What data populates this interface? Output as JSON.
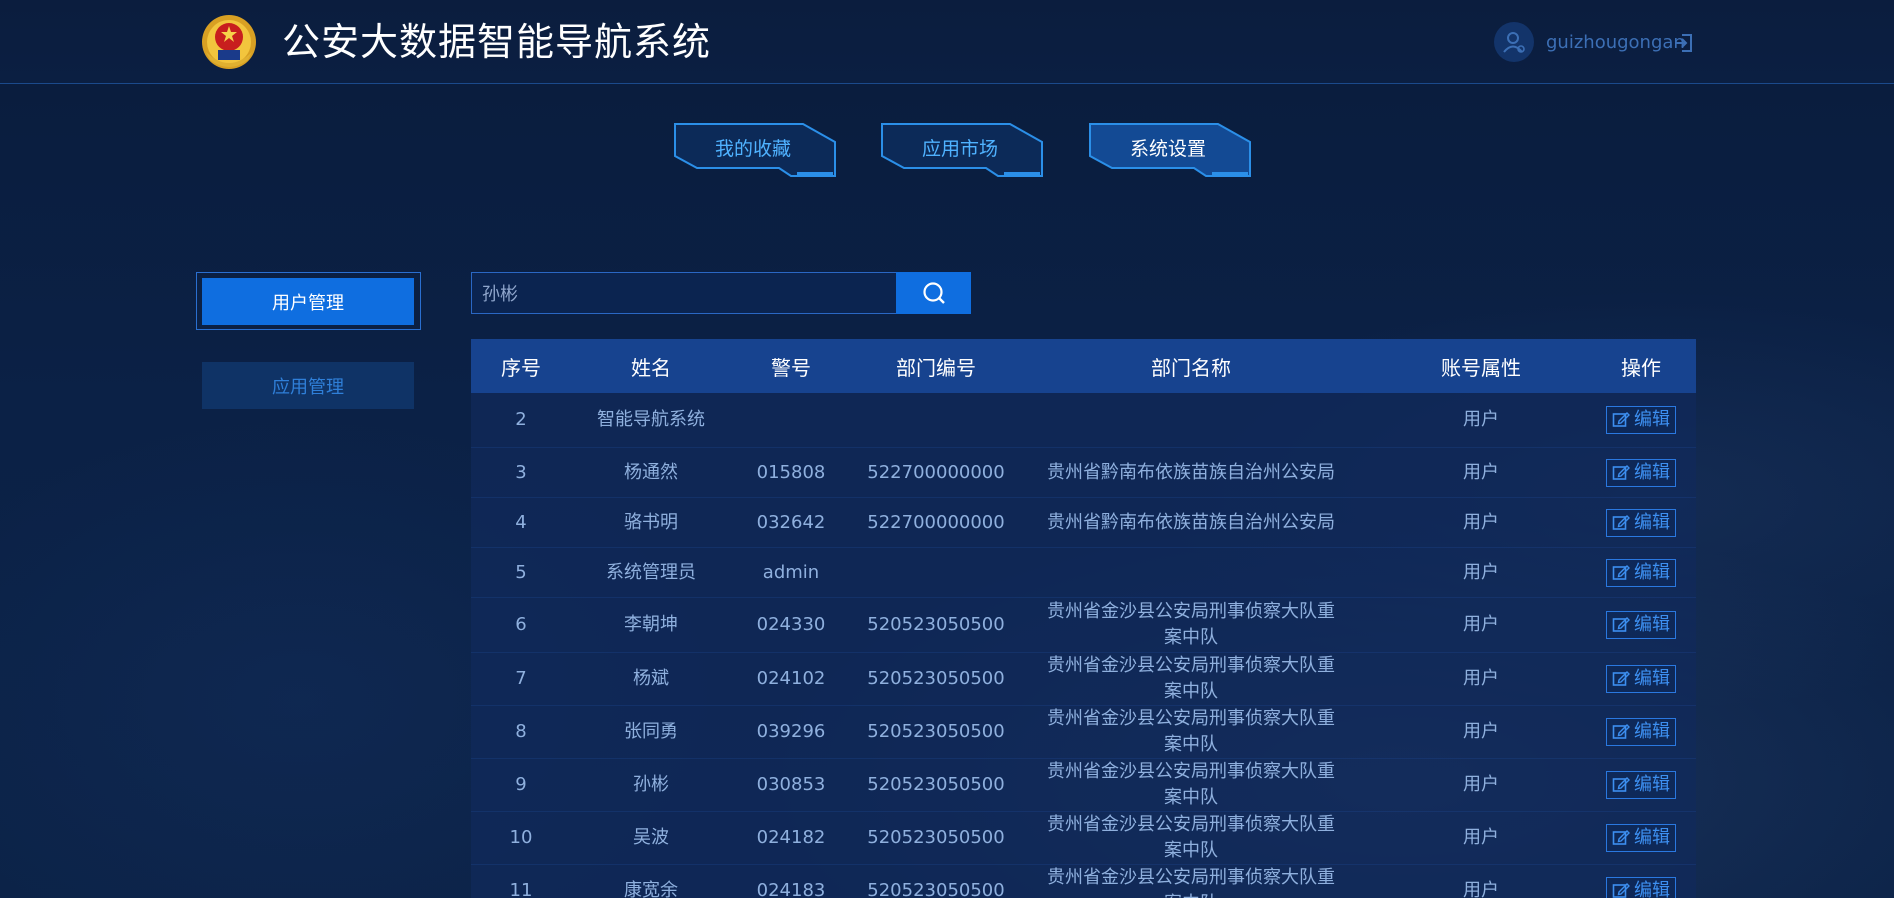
{
  "header": {
    "title": "公安大数据智能导航系统",
    "username": "guizhougongan"
  },
  "tabs": [
    {
      "label": "我的收藏",
      "active": false
    },
    {
      "label": "应用市场",
      "active": false
    },
    {
      "label": "系统设置",
      "active": true
    }
  ],
  "sidebar": {
    "items": [
      {
        "label": "用户管理",
        "active": true
      },
      {
        "label": "应用管理",
        "active": false
      }
    ]
  },
  "search": {
    "value": "孙彬"
  },
  "table": {
    "headers": [
      "序号",
      "姓名",
      "警号",
      "部门编号",
      "部门名称",
      "账号属性",
      "操作"
    ],
    "edit_label": "编辑",
    "rows": [
      {
        "no": "2",
        "name": "智能导航系统",
        "badge": "",
        "dept_code": "",
        "dept_name": "",
        "role": "用户"
      },
      {
        "no": "3",
        "name": "杨通然",
        "badge": "015808",
        "dept_code": "522700000000",
        "dept_name": "贵州省黔南布依族苗族自治州公安局",
        "role": "用户"
      },
      {
        "no": "4",
        "name": "骆书明",
        "badge": "032642",
        "dept_code": "522700000000",
        "dept_name": "贵州省黔南布依族苗族自治州公安局",
        "role": "用户"
      },
      {
        "no": "5",
        "name": "系统管理员",
        "badge": "admin",
        "dept_code": "",
        "dept_name": "",
        "role": "用户"
      },
      {
        "no": "6",
        "name": "李朝坤",
        "badge": "024330",
        "dept_code": "520523050500",
        "dept_name": "贵州省金沙县公安局刑事侦察大队重案中队",
        "role": "用户"
      },
      {
        "no": "7",
        "name": "杨斌",
        "badge": "024102",
        "dept_code": "520523050500",
        "dept_name": "贵州省金沙县公安局刑事侦察大队重案中队",
        "role": "用户"
      },
      {
        "no": "8",
        "name": "张同勇",
        "badge": "039296",
        "dept_code": "520523050500",
        "dept_name": "贵州省金沙县公安局刑事侦察大队重案中队",
        "role": "用户"
      },
      {
        "no": "9",
        "name": "孙彬",
        "badge": "030853",
        "dept_code": "520523050500",
        "dept_name": "贵州省金沙县公安局刑事侦察大队重案中队",
        "role": "用户"
      },
      {
        "no": "10",
        "name": "吴波",
        "badge": "024182",
        "dept_code": "520523050500",
        "dept_name": "贵州省金沙县公安局刑事侦察大队重案中队",
        "role": "用户"
      },
      {
        "no": "11",
        "name": "康宽余",
        "badge": "024183",
        "dept_code": "520523050500",
        "dept_name": "贵州省金沙县公安局刑事侦察大队重案中队",
        "role": "用户"
      }
    ]
  },
  "icons": {
    "emblem": "police-emblem-icon",
    "avatar": "user-avatar-icon",
    "logout": "logout-icon",
    "search": "search-icon",
    "edit": "edit-icon"
  },
  "colors": {
    "background": "#0a1e40",
    "accent": "#0f6ee0",
    "table_header": "#17438f",
    "tab_text": "#4fb2ff"
  }
}
